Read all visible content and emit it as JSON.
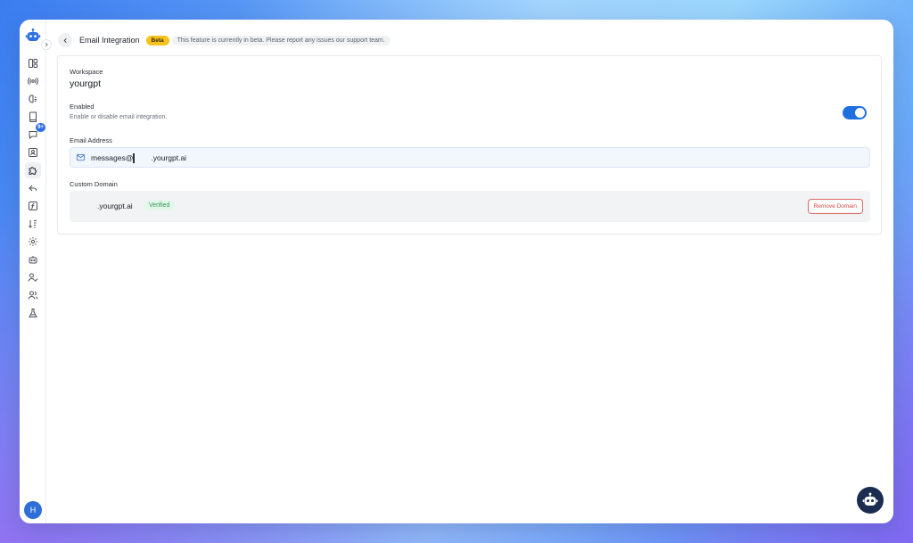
{
  "colors": {
    "accent": "#1f6fe0",
    "beta": "#f6c31c",
    "verified": "#2e9a56",
    "danger": "#d84545"
  },
  "sidebar": {
    "collapse_icon": "chevron-right-icon",
    "items": [
      {
        "icon": "dashboard-icon"
      },
      {
        "icon": "broadcast-icon"
      },
      {
        "icon": "brain-icon"
      },
      {
        "icon": "book-icon"
      },
      {
        "icon": "chat-icon",
        "badge": "9+"
      },
      {
        "icon": "contact-icon"
      },
      {
        "icon": "puzzle-icon",
        "active": true
      },
      {
        "icon": "reply-icon"
      },
      {
        "icon": "function-icon"
      },
      {
        "icon": "sort-icon"
      },
      {
        "icon": "settings-icon"
      },
      {
        "icon": "robot-icon"
      },
      {
        "icon": "user-check-icon"
      },
      {
        "icon": "users-icon"
      },
      {
        "icon": "flask-icon"
      }
    ],
    "avatar_initial": "H"
  },
  "header": {
    "title": "Email Integration",
    "beta_label": "Beta",
    "beta_notice": "This feature is currently in beta. Please report any issues our support team."
  },
  "workspace": {
    "label": "Workspace",
    "value": "yourgpt"
  },
  "enabled": {
    "label": "Enabled",
    "help": "Enable or disable email integration.",
    "on": true
  },
  "email": {
    "label": "Email Address",
    "prefix": "messages@",
    "domain": ".yourgpt.ai"
  },
  "custom_domain": {
    "label": "Custom Domain",
    "domain": ".yourgpt.ai",
    "status": "Verified",
    "remove_label": "Remove Domain"
  }
}
